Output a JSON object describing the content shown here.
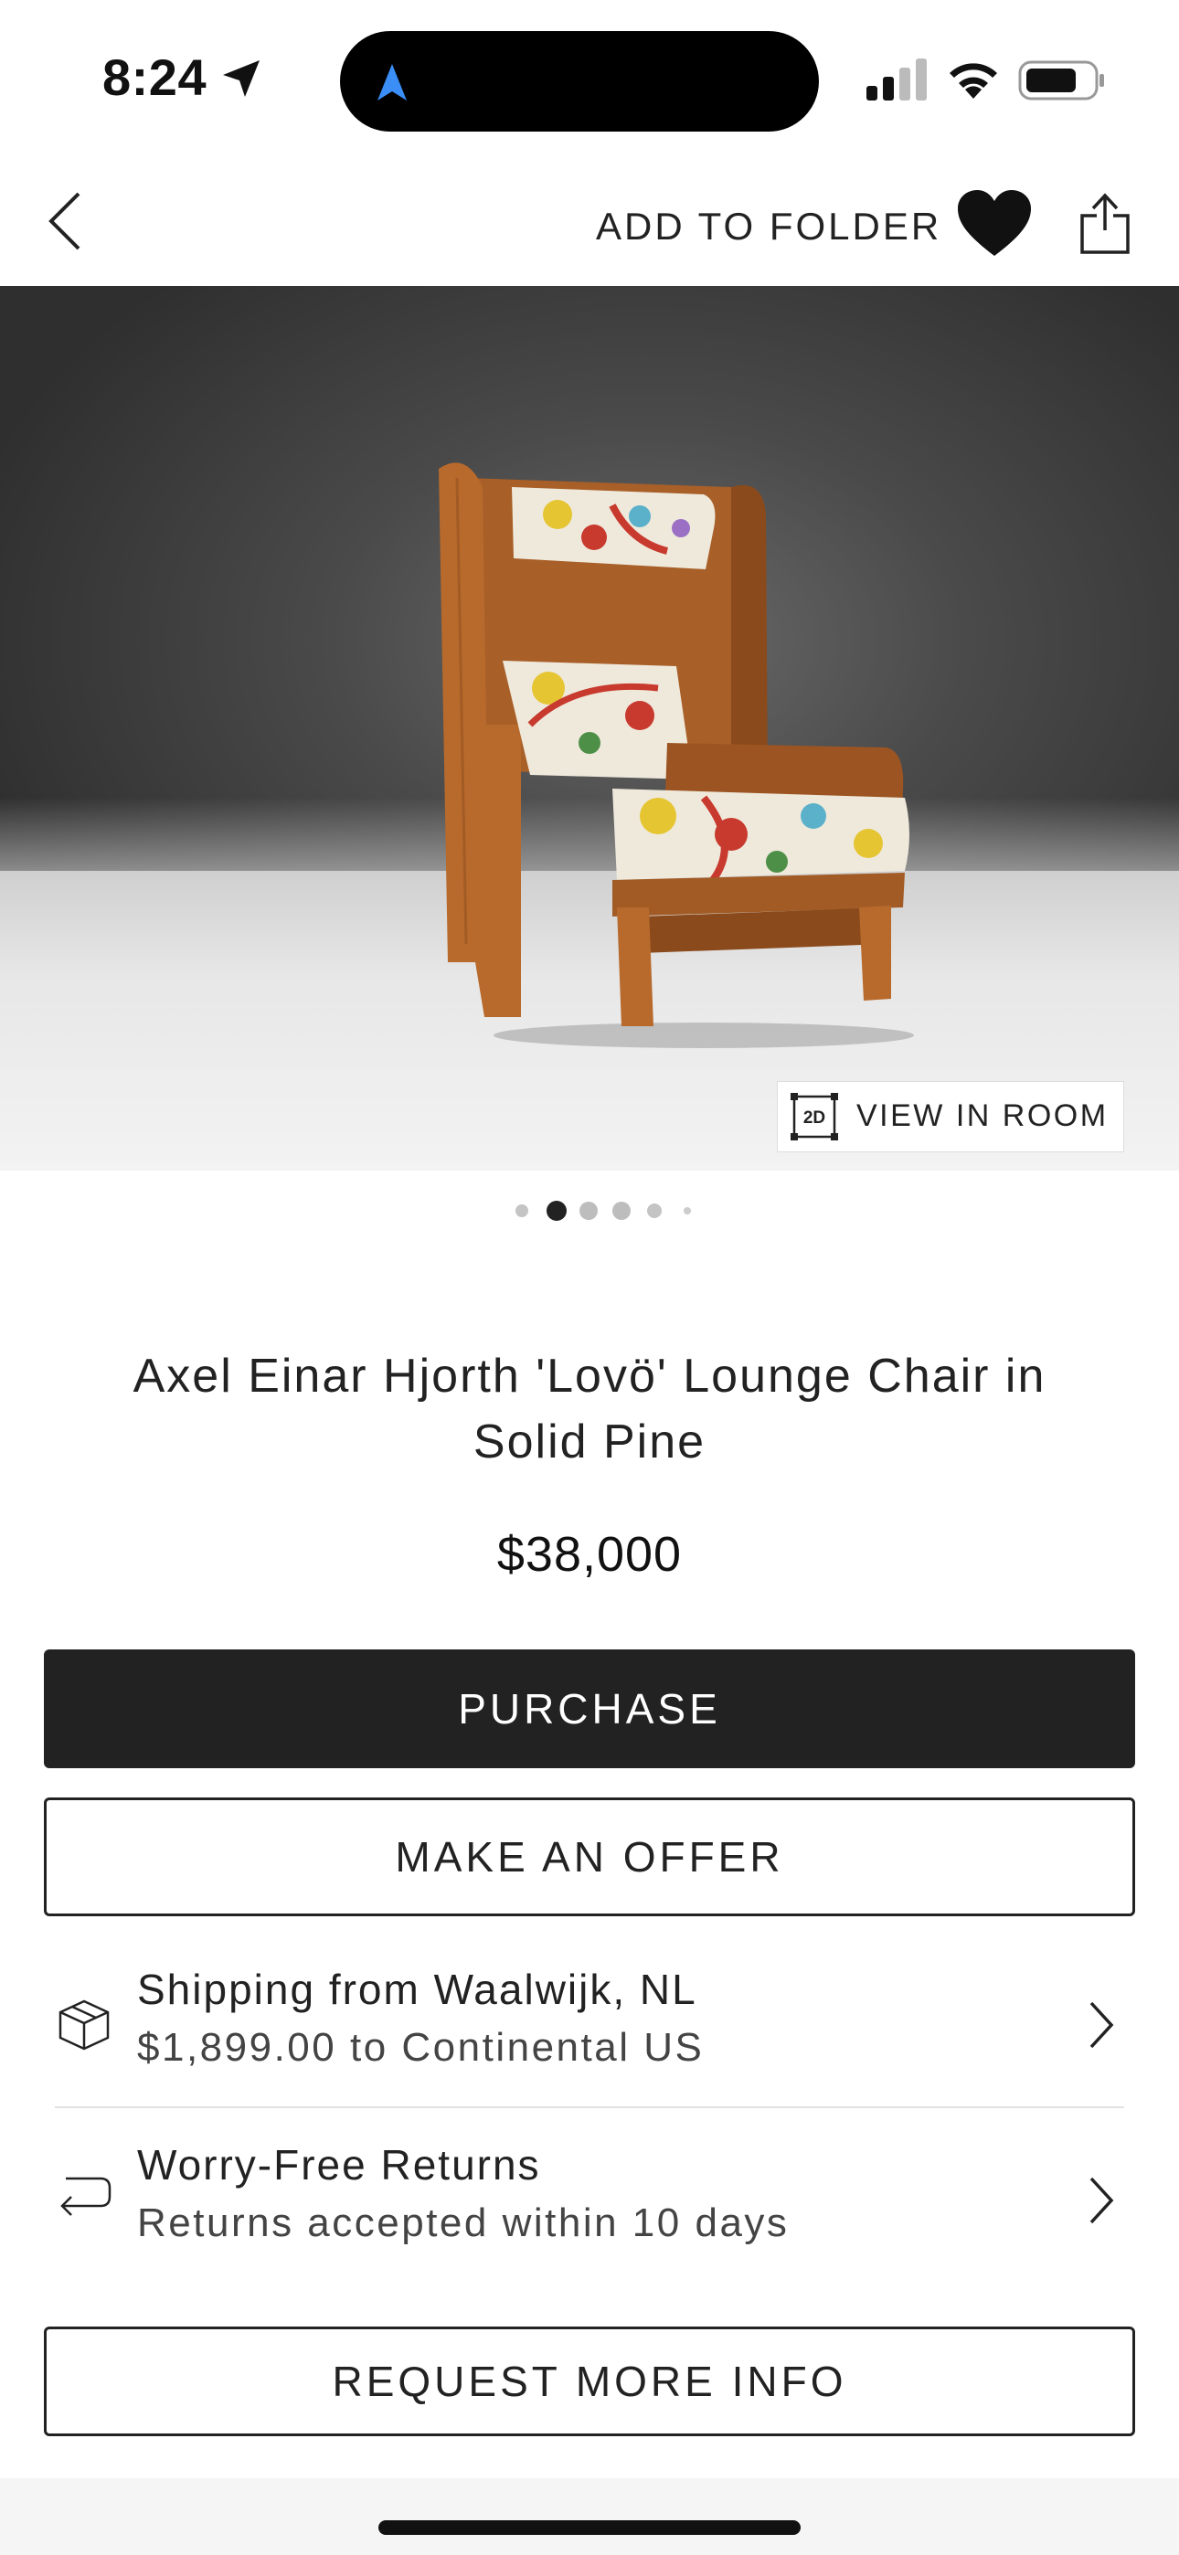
{
  "status_bar": {
    "time": "8:24",
    "icons": [
      "location-arrow-icon",
      "navigation-icon",
      "cellular-signal-icon",
      "wifi-icon",
      "battery-icon"
    ]
  },
  "nav": {
    "back_icon": "chevron-left-icon",
    "add_to_folder_label": "ADD TO FOLDER",
    "favorite_icon": "heart-icon",
    "share_icon": "share-icon"
  },
  "hero": {
    "image": "wingback lounge chair in pine with floral upholstery",
    "view_in_room": {
      "badge": "2D",
      "label": "VIEW IN ROOM"
    },
    "carousel": {
      "count": 6,
      "active_index": 1
    }
  },
  "product": {
    "title": "Axel Einar Hjorth 'Lovö' Lounge Chair in Solid Pine",
    "price": "$38,000"
  },
  "actions": {
    "purchase": "PURCHASE",
    "make_offer": "MAKE AN OFFER",
    "request_info": "REQUEST MORE INFO"
  },
  "details": [
    {
      "icon": "package-icon",
      "title": "Shipping from Waalwijk, NL",
      "subtitle": "$1,899.00 to Continental US"
    },
    {
      "icon": "return-arrow-icon",
      "title": "Worry-Free Returns",
      "subtitle": "Returns accepted within 10 days"
    }
  ],
  "colors": {
    "primary_button": "#222222",
    "text": "#222222",
    "navigation_accent": "#3a8ef6"
  }
}
